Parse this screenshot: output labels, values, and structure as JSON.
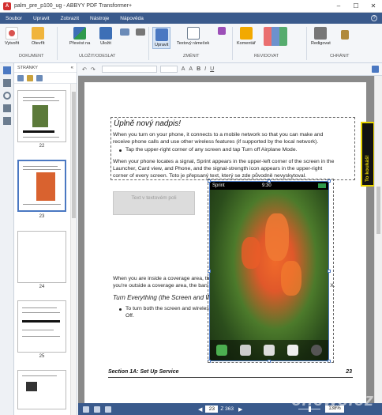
{
  "window": {
    "title": "palm_pre_p100_ug - ABBYY PDF Transformer+",
    "app_icon_letter": "A",
    "minimize": "–",
    "maximize": "☐",
    "close": "✕"
  },
  "menu": [
    "Soubor",
    "Upravit",
    "Zobrazit",
    "Nástroje",
    "Nápověda"
  ],
  "menu_help_symbol": "?",
  "ribbon": {
    "buttons": [
      {
        "label": "Vytvořit",
        "color": "#d9534f"
      },
      {
        "label": "Otevřít",
        "color": "#f0b43c"
      },
      {
        "label": "Převést na",
        "color": "#3d6fb6"
      },
      {
        "label": "Uložit",
        "color": "#3d6fb6"
      },
      {
        "label": "Upravit",
        "color": "#4a78c2"
      },
      {
        "label": "Textový rámeček",
        "color": "#6b7c8f"
      },
      {
        "label": "Komentář",
        "color": "#f2a900"
      },
      {
        "label": "Redigovat",
        "color": "#777777"
      }
    ],
    "groups": [
      "DOKUMENT",
      "ULOŽIT/ODESLAT",
      "ZMĚNIT",
      "REVIDOVAT",
      "CHRÁNIT"
    ]
  },
  "pages_panel": {
    "header": "STRÁNKY",
    "thumbnails": [
      {
        "label": "22",
        "selected": false
      },
      {
        "label": "23",
        "selected": true
      },
      {
        "label": "24",
        "selected": false
      },
      {
        "label": "25",
        "selected": false
      }
    ]
  },
  "doc_toolbar": {
    "undo": "↶",
    "redo": "↷",
    "font_size_up": "A",
    "font_size_down": "A",
    "bold": "B",
    "italic": "I",
    "underline": "U"
  },
  "document": {
    "heading": "Úplně nový nadpis!",
    "para1_line1": "When you turn on your phone, it connects to a mobile network so that you can make and",
    "para1_line2": "receive phone calls and use other wireless features (if supported by the local network).",
    "bullet1": "Tap the upper-right corner of any screen and tap Turn off Airplane Mode.",
    "para2_line1": "When your phone locates a signal, Sprint appears in the upper-left corner of the screen in the",
    "para2_line2": "Launcher, Card view, and Phone, and the signal-strength icon appears in the upper-right",
    "para2_line3": "corner of every screen. Toto je přepsaný text, který se zde původně nevyskytoval.",
    "textbox_placeholder": "Text v textovém poli",
    "para3_line1": "When you are inside a coverage area, the bars on the signal-strength icon are filled in. If",
    "para3_line2": "you're outside a coverage area, the bars in the signal-strength icon appear dimmed with an X.",
    "subheading": "Turn Everything (the Screen and Wireless Services) On/Off",
    "bullet2_line1": "To turn both the screen and wireless services off: Press and hold power and tap Turn",
    "bullet2_line2": "Off.",
    "footer_left": "Section 1A: Set Up Service",
    "footer_right": "23",
    "phone_carrier": "Sprint",
    "phone_time": "9:30",
    "sticky_note": "To koukáš!"
  },
  "statusbar": {
    "current_page": "23",
    "total_pages": "Z 363",
    "zoom": "138%"
  },
  "watermark": "cnews.cz"
}
